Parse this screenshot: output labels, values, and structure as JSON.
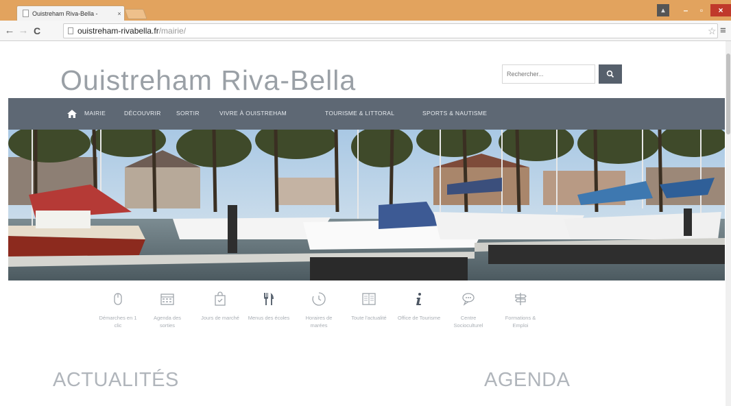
{
  "browser": {
    "tab_title": "Ouistreham Riva-Bella -",
    "tab_close": "×",
    "url_host": "ouistreham-rivabella.fr",
    "url_path": "/mairie/"
  },
  "site": {
    "title": "Ouistreham Riva-Bella",
    "search_placeholder": "Rechercher...",
    "nav": [
      "MAIRIE",
      "DÉCOUVRIR",
      "SORTIR",
      "VIVRE À OUISTREHAM",
      "TOURISME & LITTORAL",
      "SPORTS & NAUTISME"
    ]
  },
  "quicklinks": [
    {
      "label": "Démarches en 1 clic",
      "icon": "mouse-icon"
    },
    {
      "label": "Agenda des sorties",
      "icon": "calendar-icon"
    },
    {
      "label": "Jours de marché",
      "icon": "market-bag-icon"
    },
    {
      "label": "Menus des écoles",
      "icon": "cutlery-icon"
    },
    {
      "label": "Horaires de marées",
      "icon": "clock-icon"
    },
    {
      "label": "Toute l'actualité",
      "icon": "newspaper-icon"
    },
    {
      "label": "Office de Tourisme",
      "icon": "info-icon"
    },
    {
      "label": "Centre Socioculturel",
      "icon": "chat-bubble-icon"
    },
    {
      "label": "Formations & Emploi",
      "icon": "signpost-icon"
    }
  ],
  "sections": {
    "news": "ACTUALITÉS",
    "agenda": "AGENDA"
  },
  "colors": {
    "chrome_accent": "#e2a35e",
    "nav_bg": "#5e6874",
    "title_gray": "#9aa0a6"
  }
}
